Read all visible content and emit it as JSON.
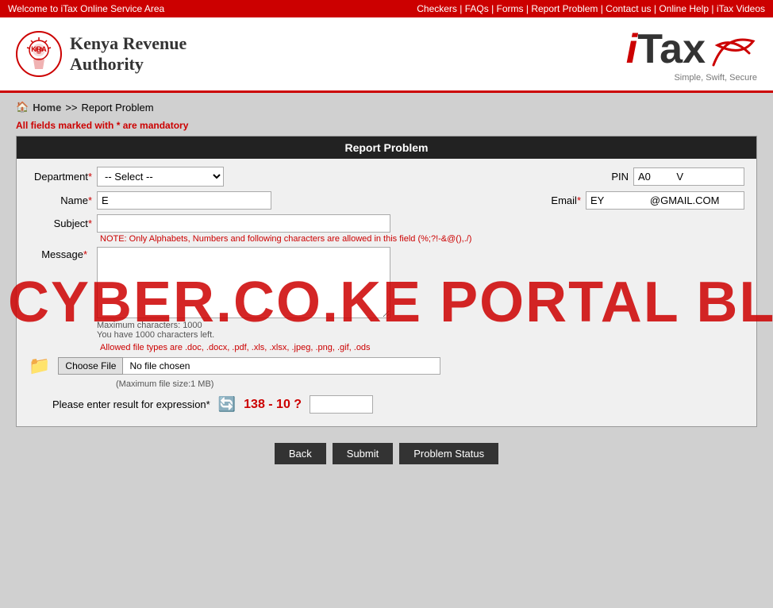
{
  "topbar": {
    "welcome": "Welcome to iTax Online Service Area",
    "links": [
      "Checkers",
      "FAQs",
      "Forms",
      "Report Problem",
      "Contact us",
      "Online Help",
      "iTax Videos"
    ]
  },
  "header": {
    "kra_line1": "Kenya Revenue",
    "kra_line2": "Authority",
    "itax_i": "i",
    "itax_tax": "Tax",
    "tagline": "Simple, Swift, Secure"
  },
  "breadcrumb": {
    "home_label": "Home",
    "separator": ">>",
    "current": "Report Problem"
  },
  "mandatory_notice": "All fields marked with * are mandatory",
  "form": {
    "title": "Report Problem",
    "department_label": "Department",
    "department_default": "-- Select --",
    "department_required": true,
    "pin_label": "PIN",
    "pin_value": "A0",
    "pin_suffix": "V",
    "name_label": "Name",
    "name_value": "E",
    "name_required": true,
    "email_label": "Email",
    "email_value": "EY",
    "email_suffix": "@GMAIL.COM",
    "email_required": true,
    "subject_label": "Subject",
    "subject_required": true,
    "subject_note": "NOTE: Only Alphabets, Numbers and following characters are allowed in this field (%;?!-&@(),./)",
    "message_label": "Message",
    "message_required": true,
    "message_max": "Maximum characters: 1000",
    "message_left": "You have 1000 characters left.",
    "file_label": "Allowed file types are .doc, .docx, .pdf, .xls, .xlsx, .jpeg, .png, .gif, .ods",
    "file_size_note": "(Maximum file size:1 MB)",
    "choose_file_btn": "Choose File",
    "no_file_text": "No file chosen",
    "captcha_label": "Please enter result for expression",
    "captcha_expression": "138 - 10 ?",
    "captcha_required": true,
    "back_btn": "Back",
    "submit_btn": "Submit",
    "status_btn": "Problem Status"
  },
  "watermark": {
    "text": "CYBER.CO.KE PORTAL BLOG"
  }
}
